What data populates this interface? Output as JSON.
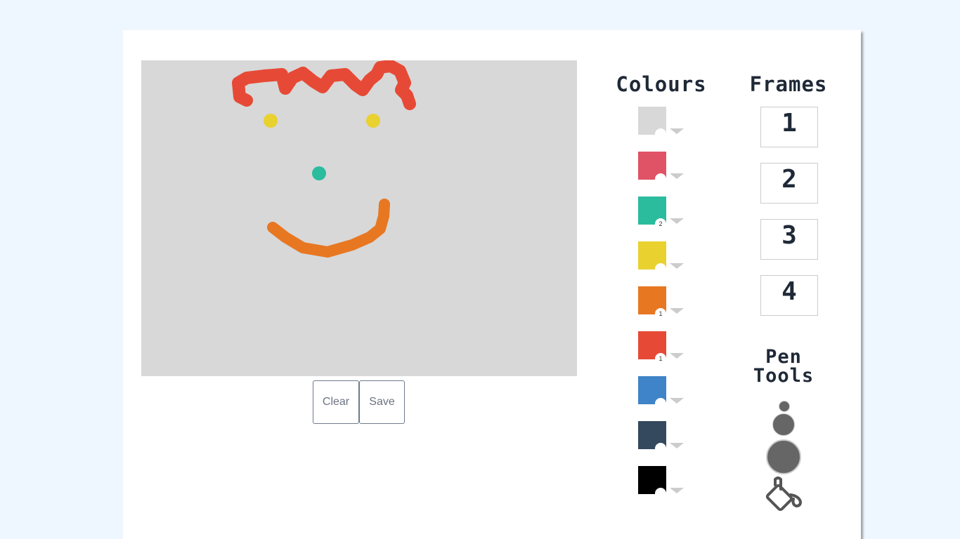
{
  "buttons": {
    "clear_label": "Clear",
    "save_label": "Save"
  },
  "headings": {
    "colours": "Colours",
    "frames": "Frames",
    "pen_tools_line1": "Pen",
    "pen_tools_line2": "Tools"
  },
  "colours": [
    {
      "color": "#d8d8d8",
      "badge": ""
    },
    {
      "color": "#e05265",
      "badge": ""
    },
    {
      "color": "#2bbc9e",
      "badge": "2"
    },
    {
      "color": "#e9d130",
      "badge": ""
    },
    {
      "color": "#e87722",
      "badge": "1"
    },
    {
      "color": "#e64a36",
      "badge": "1"
    },
    {
      "color": "#3f83c8",
      "badge": ""
    },
    {
      "color": "#34495e",
      "badge": ""
    },
    {
      "color": "#000000",
      "badge": ""
    }
  ],
  "frames": [
    "1",
    "2",
    "3",
    "4"
  ],
  "pen_tools": [
    "small-pen",
    "medium-pen",
    "large-pen",
    "fill-bucket"
  ],
  "canvas": {
    "background": "#d8d8d8"
  }
}
